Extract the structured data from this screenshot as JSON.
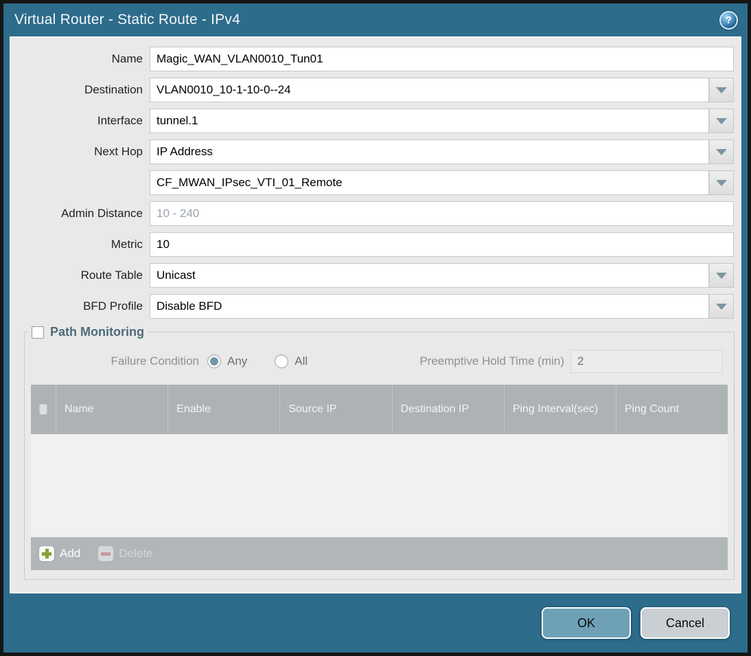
{
  "window": {
    "title": "Virtual Router - Static Route - IPv4",
    "help_icon_glyph": "?",
    "colors": {
      "titlebar_teal": "#2d6c8b",
      "body_gray": "#e9e9e9",
      "table_header_gray": "#adb2b5",
      "ok_button": "#6fa1b6",
      "cancel_button": "#cacfd3",
      "add_icon_green": "#84a239",
      "delete_icon_red": "#cf9396",
      "radio_selected": "#7097a9"
    }
  },
  "form": {
    "fields": [
      {
        "label": "Name",
        "value": "Magic_WAN_VLAN0010_Tun01",
        "type": "text"
      },
      {
        "label": "Destination",
        "value": "VLAN0010_10-1-10-0--24",
        "type": "dropdown"
      },
      {
        "label": "Interface",
        "value": "tunnel.1",
        "type": "dropdown"
      },
      {
        "label": "Next Hop",
        "value": "IP Address",
        "type": "dropdown"
      },
      {
        "label": "",
        "value": "CF_MWAN_IPsec_VTI_01_Remote",
        "type": "dropdown"
      },
      {
        "label": "Admin Distance",
        "value": "",
        "placeholder": "10 - 240",
        "type": "text"
      },
      {
        "label": "Metric",
        "value": "10",
        "type": "text"
      },
      {
        "label": "Route Table",
        "value": "Unicast",
        "type": "dropdown"
      },
      {
        "label": "BFD Profile",
        "value": "Disable BFD",
        "type": "dropdown"
      }
    ]
  },
  "path_monitoring": {
    "legend": "Path Monitoring",
    "checkbox_checked": false,
    "failure_condition": {
      "label": "Failure Condition",
      "options": [
        {
          "label": "Any",
          "selected": true
        },
        {
          "label": "All",
          "selected": false
        }
      ]
    },
    "preemptive_hold": {
      "label": "Preemptive Hold Time (min)",
      "value": "2"
    },
    "table": {
      "columns": [
        "Name",
        "Enable",
        "Source IP",
        "Destination IP",
        "Ping Interval(sec)",
        "Ping Count"
      ],
      "rows": [],
      "add_label": "Add",
      "delete_label": "Delete"
    }
  },
  "footer": {
    "ok_label": "OK",
    "cancel_label": "Cancel"
  }
}
